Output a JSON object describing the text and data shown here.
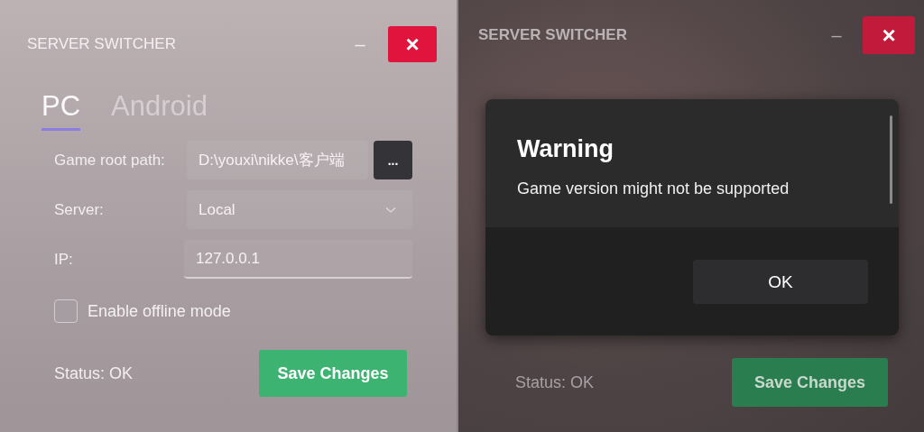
{
  "windows": [
    {
      "title": "SERVER SWITCHER",
      "minimize": "–",
      "close": "×",
      "tabs": [
        {
          "label": "PC",
          "selected": true
        },
        {
          "label": "Android",
          "selected": false
        }
      ],
      "fields": [
        {
          "kind": "path",
          "label": "Game root path:",
          "value": "D:\\youxi\\nikke\\客户端",
          "button": "..."
        },
        {
          "kind": "dropdown",
          "label": "Server:",
          "value": "Local"
        },
        {
          "kind": "text",
          "label": "IP:",
          "value": "127.0.0.1"
        }
      ],
      "checkbox": {
        "label": "Enable offline mode",
        "checked": false
      },
      "status": "Status: OK",
      "save_button": "Save Changes"
    },
    {
      "title": "SERVER SWITCHER",
      "minimize": "–",
      "close": "×",
      "status": "Status: OK",
      "save_button": "Save Changes",
      "dialog": {
        "title": "Warning",
        "message": "Game version might not be supported",
        "button": "OK"
      }
    }
  ]
}
